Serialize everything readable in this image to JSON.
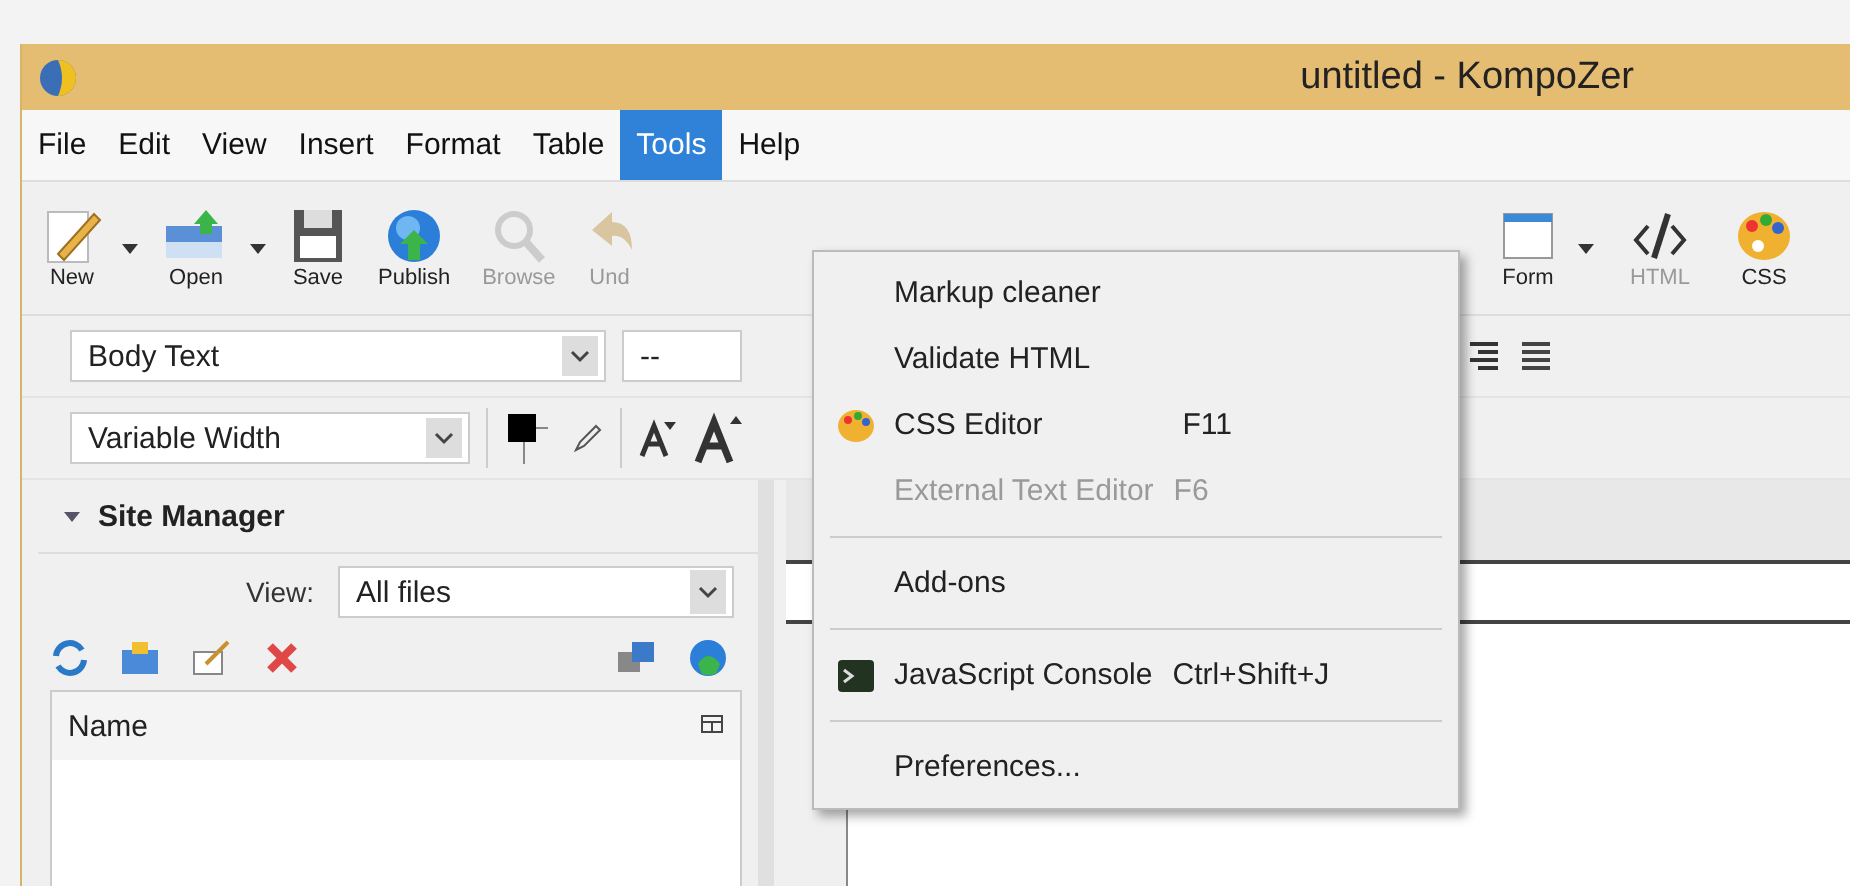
{
  "window": {
    "title": "untitled - KompoZer"
  },
  "menu_bar": [
    {
      "label": "File",
      "selected": false
    },
    {
      "label": "Edit",
      "selected": false
    },
    {
      "label": "View",
      "selected": false
    },
    {
      "label": "Insert",
      "selected": false
    },
    {
      "label": "Format",
      "selected": false
    },
    {
      "label": "Table",
      "selected": false
    },
    {
      "label": "Tools",
      "selected": true
    },
    {
      "label": "Help",
      "selected": false
    }
  ],
  "toolbar_left": [
    {
      "label": "New",
      "kind": "new",
      "dropdown": true,
      "disabled": false
    },
    {
      "label": "Open",
      "kind": "open",
      "dropdown": true,
      "disabled": false
    },
    {
      "label": "Save",
      "kind": "save",
      "dropdown": false,
      "disabled": false
    },
    {
      "label": "Publish",
      "kind": "publish",
      "dropdown": false,
      "disabled": false
    },
    {
      "label": "Browse",
      "kind": "browse",
      "dropdown": false,
      "disabled": true
    },
    {
      "label": "Und",
      "kind": "undo",
      "dropdown": false,
      "disabled": true
    }
  ],
  "toolbar_right": [
    {
      "label": "Form",
      "kind": "form",
      "dropdown": true,
      "disabled": false
    },
    {
      "label": "HTML",
      "kind": "html",
      "dropdown": false,
      "disabled": true
    },
    {
      "label": "CSS",
      "kind": "css",
      "dropdown": false,
      "disabled": false
    }
  ],
  "format_bar": {
    "paragraph_style": "Body Text",
    "class_select": "--",
    "font": "Variable Width"
  },
  "tools_menu": [
    {
      "kind": "command",
      "label": "Markup cleaner",
      "disabled": false
    },
    {
      "kind": "command",
      "label": "Validate HTML",
      "disabled": false
    },
    {
      "kind": "palette-command",
      "label": "CSS Editor",
      "shortcut": "F11",
      "disabled": false
    },
    {
      "kind": "command",
      "label": "External Text Editor",
      "shortcut": "F6",
      "disabled": true
    },
    {
      "kind": "separator"
    },
    {
      "kind": "command",
      "label": "Add-ons",
      "disabled": false
    },
    {
      "kind": "separator"
    },
    {
      "kind": "console-command",
      "label": "JavaScript Console",
      "shortcut": "Ctrl+Shift+J",
      "disabled": false
    },
    {
      "kind": "separator"
    },
    {
      "kind": "command",
      "label": "Preferences...",
      "disabled": false
    }
  ],
  "site_manager": {
    "title": "Site Manager",
    "expanded": true,
    "view_label": "View:",
    "view_value": "All files",
    "column": "Name"
  }
}
